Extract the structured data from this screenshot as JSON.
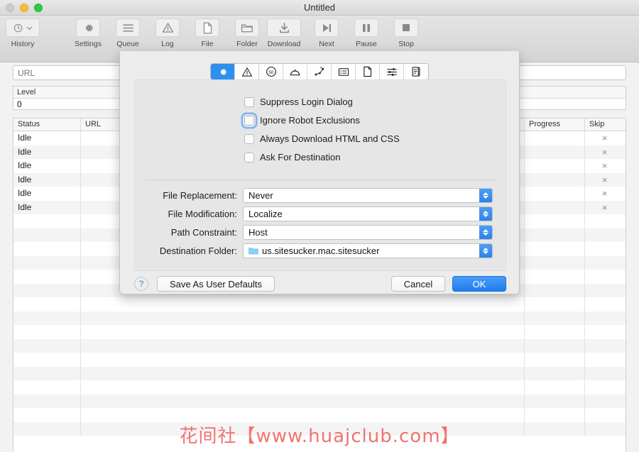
{
  "window": {
    "title": "Untitled",
    "traffic_lights": [
      "close-button",
      "minimize-button",
      "maximize-button"
    ]
  },
  "toolbar": {
    "left_items": [
      {
        "label": "History",
        "icon": "clock-history-icon"
      }
    ],
    "center_items": [
      {
        "label": "Settings",
        "icon": "gear-icon"
      },
      {
        "label": "Queue",
        "icon": "list-lines-icon"
      },
      {
        "label": "Log",
        "icon": "warning-triangle-icon"
      },
      {
        "label": "File",
        "icon": "document-page-icon"
      },
      {
        "label": "Folder",
        "icon": "folder-open-icon"
      }
    ],
    "right_items": [
      {
        "label": "Download",
        "icon": "download-arrow-icon"
      },
      {
        "label": "Next",
        "icon": "skip-next-icon"
      },
      {
        "label": "Pause",
        "icon": "pause-icon"
      },
      {
        "label": "Stop",
        "icon": "stop-square-icon"
      }
    ]
  },
  "main": {
    "url_field": {
      "value": "",
      "placeholder": "URL"
    },
    "level_table": {
      "header": "Level",
      "value": "0"
    },
    "queue_table": {
      "columns": [
        "Status",
        "URL",
        "Progress",
        "Skip"
      ],
      "rows": [
        {
          "status": "Idle",
          "url": "",
          "progress": "",
          "skip": "×"
        },
        {
          "status": "Idle",
          "url": "",
          "progress": "",
          "skip": "×"
        },
        {
          "status": "Idle",
          "url": "",
          "progress": "",
          "skip": "×"
        },
        {
          "status": "Idle",
          "url": "",
          "progress": "",
          "skip": "×"
        },
        {
          "status": "Idle",
          "url": "",
          "progress": "",
          "skip": "×"
        },
        {
          "status": "Idle",
          "url": "",
          "progress": "",
          "skip": "×"
        }
      ],
      "empty_row_count": 16
    }
  },
  "dialog": {
    "tabs": [
      {
        "icon": "gear-icon",
        "active": true
      },
      {
        "icon": "warning-triangle-icon",
        "active": false
      },
      {
        "icon": "speed-limit-icon",
        "active": false
      },
      {
        "icon": "server-dome-icon",
        "active": false
      },
      {
        "icon": "network-nodes-icon",
        "active": false
      },
      {
        "icon": "form-list-icon",
        "active": false
      },
      {
        "icon": "document-page-icon",
        "active": false
      },
      {
        "icon": "sliders-icon",
        "active": false
      },
      {
        "icon": "script-scroll-icon",
        "active": false
      }
    ],
    "checkboxes": [
      {
        "label": "Suppress Login Dialog",
        "checked": false,
        "focused": false
      },
      {
        "label": "Ignore Robot Exclusions",
        "checked": false,
        "focused": true
      },
      {
        "label": "Always Download HTML and CSS",
        "checked": false,
        "focused": false
      },
      {
        "label": "Ask For Destination",
        "checked": false,
        "focused": false
      }
    ],
    "fields": [
      {
        "label": "File Replacement:",
        "value": "Never",
        "icon": null
      },
      {
        "label": "File Modification:",
        "value": "Localize",
        "icon": null
      },
      {
        "label": "Path Constraint:",
        "value": "Host",
        "icon": null
      },
      {
        "label": "Destination Folder:",
        "value": "us.sitesucker.mac.sitesucker",
        "icon": "folder-icon"
      }
    ],
    "buttons": {
      "help": "?",
      "save_defaults": "Save As User Defaults",
      "cancel": "Cancel",
      "ok": "OK"
    }
  },
  "watermark": {
    "text": "花间社【www.huajclub.com】",
    "color": "#f2736f"
  },
  "colors": {
    "accent_blue": "#2f8fef",
    "toolbar_bg": "#dcdcdc",
    "dialog_bg": "#ececec",
    "panel_bg": "#e6e6e6"
  }
}
